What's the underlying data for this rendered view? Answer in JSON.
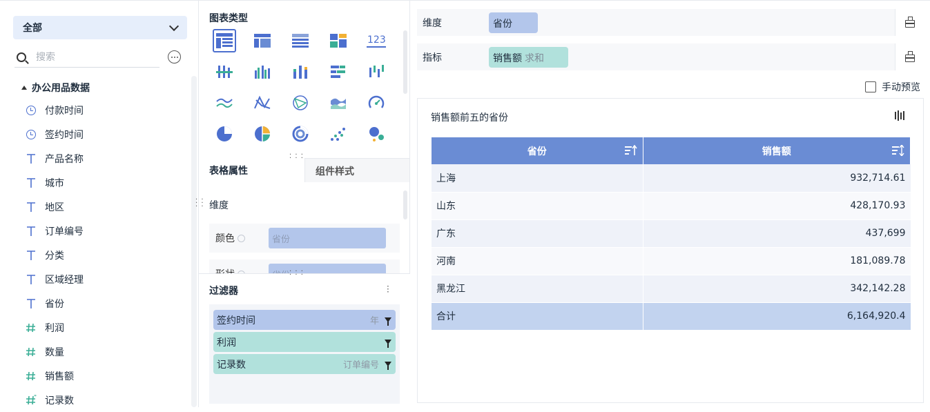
{
  "left": {
    "dataset_select": "全部",
    "search_placeholder": "搜索",
    "tree_root": "办公用品数据",
    "fields": [
      {
        "label": "付款时间",
        "type": "date"
      },
      {
        "label": "签约时间",
        "type": "date"
      },
      {
        "label": "产品名称",
        "type": "text"
      },
      {
        "label": "城市",
        "type": "text"
      },
      {
        "label": "地区",
        "type": "text"
      },
      {
        "label": "订单编号",
        "type": "text"
      },
      {
        "label": "分类",
        "type": "text"
      },
      {
        "label": "区域经理",
        "type": "text"
      },
      {
        "label": "省份",
        "type": "text"
      },
      {
        "label": "利润",
        "type": "number"
      },
      {
        "label": "数量",
        "type": "number"
      },
      {
        "label": "销售额",
        "type": "number"
      },
      {
        "label": "记录数",
        "type": "number-special"
      }
    ]
  },
  "middle": {
    "chart_types_title": "图表类型",
    "chart_types": [
      "table-icon",
      "crosstab-icon",
      "detail-table-icon",
      "kpi-block-icon",
      "number-123-icon",
      "grouped-column-icon",
      "multi-column-icon",
      "stacked-column-icon",
      "bar-icon",
      "range-column-icon",
      "line-icon",
      "radar-line-icon",
      "scatter-line-icon",
      "area-icon",
      "gauge-icon",
      "pie-icon",
      "multi-pie-icon",
      "ring-icon",
      "scatter-icon",
      "bubble-icon"
    ],
    "number_glyph": "123",
    "tab_table_props": "表格属性",
    "tab_component_style": "组件样式",
    "dimension_label": "维度",
    "color_label": "颜色",
    "color_chip": "省份",
    "shape_label": "形状",
    "shape_chip": "省份",
    "filter_title": "过滤器",
    "filters": [
      {
        "label": "签约时间",
        "extra": "年",
        "color": "blue"
      },
      {
        "label": "利润",
        "extra": "",
        "color": "green"
      },
      {
        "label": "记录数",
        "extra": "订单编号",
        "color": "green"
      }
    ]
  },
  "right": {
    "dimension_shelf_label": "维度",
    "dimension_chip": "省份",
    "measure_shelf_label": "指标",
    "measure_chip": "销售额",
    "measure_agg": "求和",
    "manual_preview_label": "手动预览",
    "preview_title": "销售额前五的省份",
    "table": {
      "headers": [
        "省份",
        "销售额"
      ],
      "rows": [
        {
          "province": "上海",
          "sales": "932,714.61"
        },
        {
          "province": "山东",
          "sales": "428,170.93"
        },
        {
          "province": "广东",
          "sales": "437,699"
        },
        {
          "province": "河南",
          "sales": "181,089.78"
        },
        {
          "province": "黑龙江",
          "sales": "342,142.28"
        }
      ],
      "total_label": "合计",
      "total_value": "6,164,920.4"
    }
  },
  "colors": {
    "accent": "#4c6fce",
    "dimension_chip": "#b3c6eb",
    "measure_chip": "#b1e1dc",
    "table_header": "#6a8cd4",
    "total_row": "#c2d3ef"
  }
}
